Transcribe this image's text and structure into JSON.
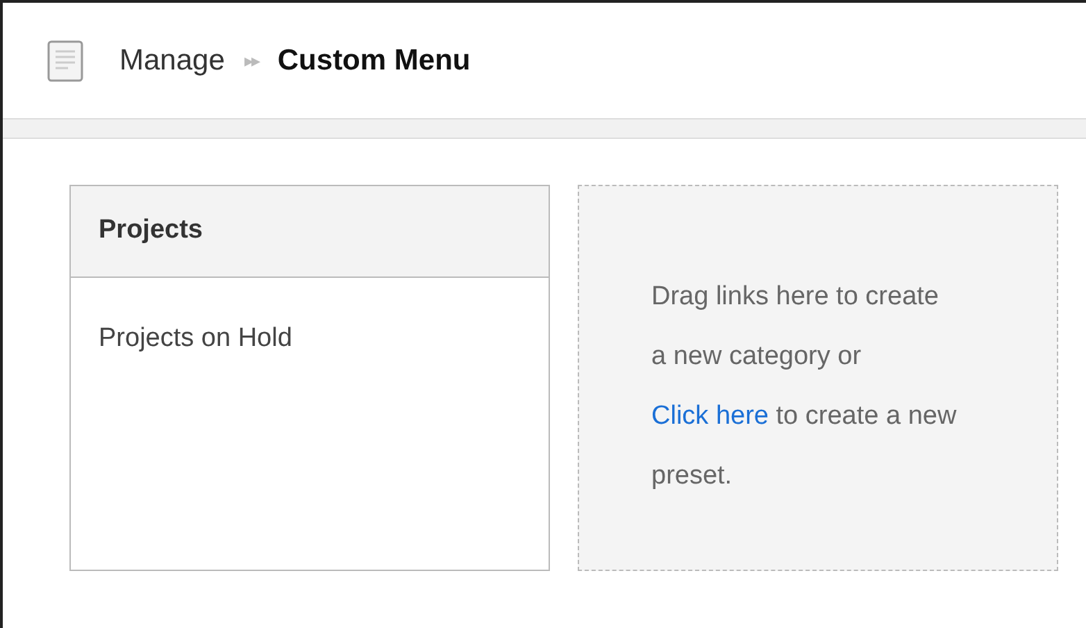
{
  "breadcrumb": {
    "parent": "Manage",
    "separator": "▸▸",
    "current": "Custom Menu"
  },
  "categories": [
    {
      "title": "Projects",
      "links": [
        "Projects on Hold"
      ]
    }
  ],
  "drop_zone": {
    "text_before": "Drag links here to create a new category or ",
    "link": "Click here",
    "text_after": " to create a new preset."
  }
}
